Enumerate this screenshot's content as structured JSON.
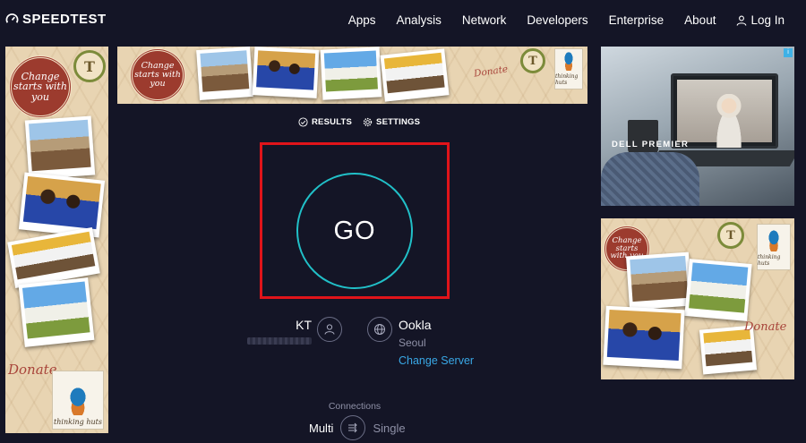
{
  "nav": {
    "logo": "SPEEDTEST",
    "links": [
      "Apps",
      "Analysis",
      "Network",
      "Developers",
      "Enterprise",
      "About"
    ],
    "login": "Log In"
  },
  "tabs": {
    "results": "RESULTS",
    "settings": "SETTINGS"
  },
  "go_label": "GO",
  "isp": {
    "name": "KT"
  },
  "server": {
    "name": "Ookla",
    "city": "Seoul",
    "change_label": "Change Server"
  },
  "connections": {
    "label": "Connections",
    "multi": "Multi",
    "single": "Single"
  },
  "ads": {
    "left": {
      "stamp": "Change starts with you",
      "donate": "Donate",
      "brand": "thinking huts",
      "seal": "T"
    },
    "top": {
      "stamp": "Change starts with you",
      "donate": "Donate",
      "brand": "thinking huts",
      "seal": "T"
    },
    "right_top": {
      "text": "DELL PREMIER"
    },
    "right_bottom": {
      "stamp": "Change starts with you",
      "donate": "Donate",
      "brand": "thinking huts",
      "seal": "T"
    }
  },
  "colors": {
    "background": "#141526",
    "go_ring": "#21c0c8",
    "link": "#39a8e6",
    "highlight": "#e0141a"
  },
  "icons": {
    "logo": "gauge-icon",
    "login": "user-icon",
    "results": "check-circle-icon",
    "settings": "gear-icon",
    "isp": "user-icon",
    "server": "globe-icon",
    "connections": "arrows-toggle-icon"
  }
}
